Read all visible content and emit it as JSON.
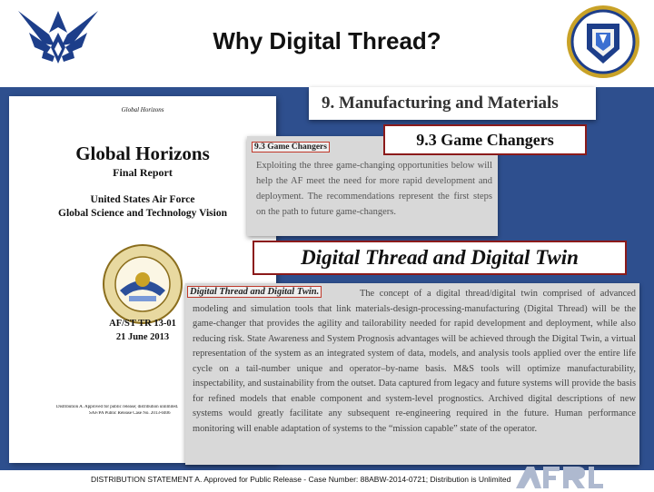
{
  "slide": {
    "title": "Why Digital Thread?",
    "footer": "DISTRIBUTION STATEMENT A.  Approved for  Public Release - Case Number: 88ABW-2014-0721;  Distribution is Unlimited",
    "logos": [
      "us-air-force-wings-logo",
      "air-force-research-laboratory-seal",
      "afrl-wordmark"
    ]
  },
  "report": {
    "header": "Global Horizons",
    "title": "Global Horizons",
    "subtitle": "Final Report",
    "org_line1": "United States Air Force",
    "org_line2": "Global Science and Technology Vision",
    "seal_text": "UNITED STATES AIR FORCE CHIEF SCIENTIST",
    "report_number": "AF/ST TR 13-01",
    "date": "21 June 2013",
    "distribution_line1": "Distribution A. Approved for public release; distribution unlimited.",
    "distribution_line2": "SAF/PA Public Release Case No. 2013-0406"
  },
  "section_banner": "9. Manufacturing and Materials",
  "game_changers": {
    "callout": "9.3 Game Changers",
    "label": "9.3 Game Changers",
    "text": "Exploiting the three game-changing opportunities below will help the AF meet the need for more rapid development and deployment. The recommendations represent the first steps on the path to future game-changers."
  },
  "digital_thread": {
    "callout": "Digital Thread and Digital Twin",
    "label": "Digital Thread and Digital Twin.",
    "text": "The concept of a digital thread/digital twin comprised of advanced modeling and simulation tools that link materials-design-processing-manufacturing (Digital Thread) will be the game-changer that provides the agility and tailorability needed for rapid development and deployment, while also reducing risk. State Awareness and System Prognosis advantages will be achieved through the Digital Twin, a virtual representation of the system as an integrated system of data, models, and analysis tools applied over the entire life cycle on a tail-number unique and operator–by-name basis. M&S tools will optimize manufacturability, inspectability, and sustainability from the outset. Data captured from legacy and future systems will provide the basis for refined models that enable component and system-level prognostics. Archived digital descriptions of new systems would greatly facilitate any subsequent re-engineering required in the future. Human performance monitoring will enable adaptation of systems to the “mission capable” state of the operator."
  },
  "colors": {
    "panel_blue": "#2e4f8e",
    "callout_border": "#8b1a1a",
    "label_border": "#c0392b",
    "excerpt_bg": "#d8d8d8"
  }
}
